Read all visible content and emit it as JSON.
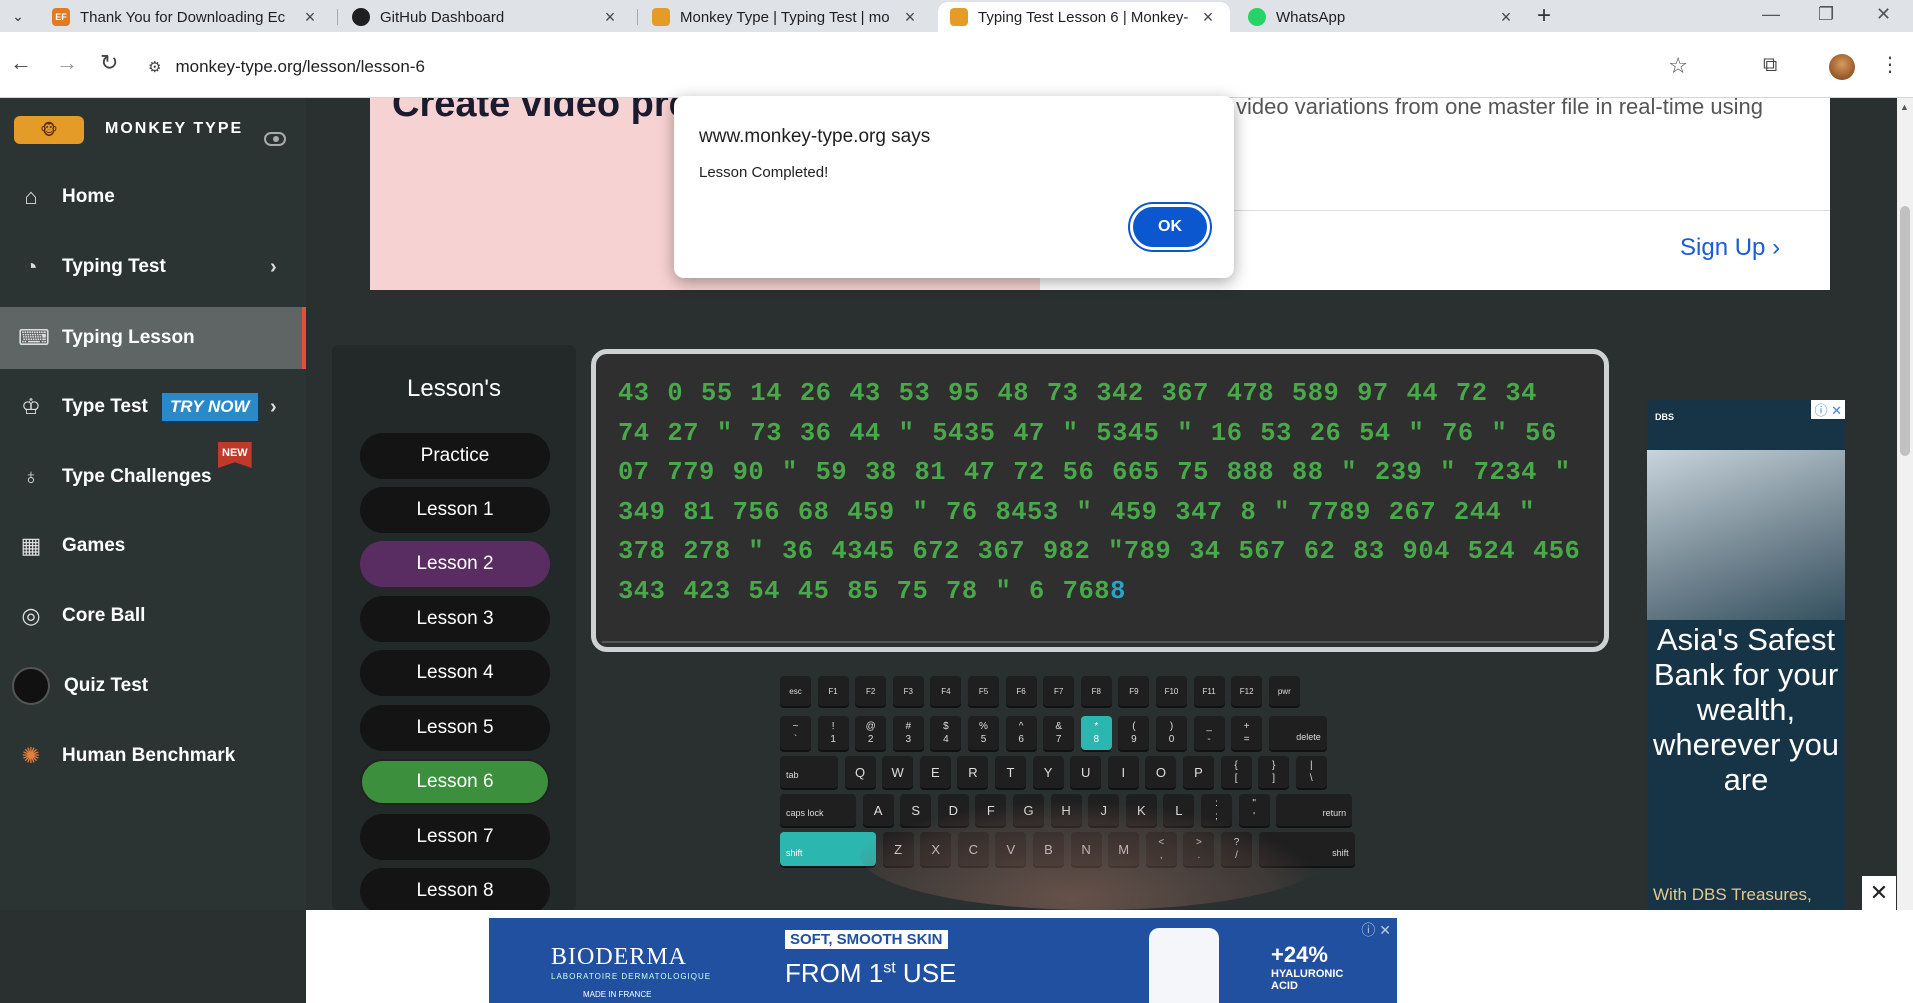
{
  "browser": {
    "tabs": [
      {
        "title": "Thank You for Downloading Ec",
        "icon": "ef-icon",
        "color": "#e27a1f",
        "glyph": "EF"
      },
      {
        "title": "GitHub Dashboard",
        "icon": "github-icon",
        "color": "#1f1f1f",
        "glyph": ""
      },
      {
        "title": "Monkey Type | Typing Test | mo",
        "icon": "monkey-type-icon",
        "color": "#e59b27",
        "glyph": ""
      },
      {
        "title": "Typing Test Lesson 6 | Monkey-",
        "icon": "monkey-type-icon",
        "color": "#e59b27",
        "glyph": ""
      },
      {
        "title": "WhatsApp",
        "icon": "whatsapp-icon",
        "color": "#25d366",
        "glyph": ""
      }
    ],
    "url": "monkey-type.org/lesson/lesson-6"
  },
  "sidebar": {
    "brand": "MONKEY TYPE",
    "items": [
      {
        "label": "Home",
        "icon": "home-icon"
      },
      {
        "label": "Typing Test",
        "icon": "github-icon"
      },
      {
        "label": "Typing Lesson",
        "icon": "keyboard-icon"
      },
      {
        "label": "Type Test",
        "icon": "crown-icon",
        "badge": "TRY NOW"
      },
      {
        "label": "Type Challenges",
        "icon": "award-icon",
        "badge": "NEW"
      },
      {
        "label": "Games",
        "icon": "grid-icon"
      },
      {
        "label": "Core Ball",
        "icon": "target-icon"
      },
      {
        "label": "Quiz Test",
        "icon": "bulb-icon"
      },
      {
        "label": "Human Benchmark",
        "icon": "brain-icon"
      }
    ]
  },
  "top_ad": {
    "headline": "Create video previews in secon",
    "description": "video variations from one master file in real-time using",
    "cta": "Sign Up"
  },
  "lessons_panel": {
    "title": "Lesson's",
    "items": [
      "Practice",
      "Lesson 1",
      "Lesson 2",
      "Lesson 3",
      "Lesson 4",
      "Lesson 5",
      "Lesson 6",
      "Lesson 7",
      "Lesson 8"
    ],
    "visited": "Lesson 2",
    "current": "Lesson 6"
  },
  "typing": {
    "text": "43 0 55 14 26 43 53 95 48 73 342 367 478 589 97 44 72 34 74 27 \" 73 36 44 \" 5435 47 \" 5345 \" 16 53 26 54 \" 76 \" 56 07 779 90 \" 59 38 81 47 72 56 665 75 888 88 \" 239 \" 7234 \" 349 81 756 68 459 \" 76 8453 \" 459 347 8 \" 7789 267 244 \" 378 278 \" 36 4345 672 367 982 \"789 34 567 62 83 904 524 456 343 423 54 45 85 75 78 \" 6 768",
    "cursor_char": "8",
    "typed_color": "#49a84a",
    "cursor_color": "#27a3c7"
  },
  "keyboard": {
    "highlighted_keys": [
      "*",
      "shift"
    ],
    "highlight_color": "#2bb7b0",
    "rows": [
      [
        {
          "t": "esc"
        },
        {
          "t": "F1"
        },
        {
          "t": "F2"
        },
        {
          "t": "F3"
        },
        {
          "t": "F4"
        },
        {
          "t": "F5"
        },
        {
          "t": "F6"
        },
        {
          "t": "F7"
        },
        {
          "t": "F8"
        },
        {
          "t": "F9"
        },
        {
          "t": "F10"
        },
        {
          "t": "F11"
        },
        {
          "t": "F12"
        },
        {
          "t": "pwr"
        }
      ],
      [
        {
          "t": "~",
          "b": "`"
        },
        {
          "t": "!",
          "b": "1"
        },
        {
          "t": "@",
          "b": "2"
        },
        {
          "t": "#",
          "b": "3"
        },
        {
          "t": "$",
          "b": "4"
        },
        {
          "t": "%",
          "b": "5"
        },
        {
          "t": "^",
          "b": "6"
        },
        {
          "t": "&",
          "b": "7"
        },
        {
          "t": "*",
          "b": "8"
        },
        {
          "t": "(",
          "b": "9"
        },
        {
          "t": ")",
          "b": "0"
        },
        {
          "t": "_",
          "b": "-"
        },
        {
          "t": "+",
          "b": "="
        },
        {
          "t": "delete"
        }
      ],
      [
        {
          "t": "tab"
        },
        {
          "t": "Q"
        },
        {
          "t": "W"
        },
        {
          "t": "E"
        },
        {
          "t": "R"
        },
        {
          "t": "T"
        },
        {
          "t": "Y"
        },
        {
          "t": "U"
        },
        {
          "t": "I"
        },
        {
          "t": "O"
        },
        {
          "t": "P"
        },
        {
          "t": "{",
          "b": "["
        },
        {
          "t": "}",
          "b": "]"
        },
        {
          "t": "|",
          "b": "\\"
        }
      ],
      [
        {
          "t": "caps lock"
        },
        {
          "t": "A"
        },
        {
          "t": "S"
        },
        {
          "t": "D"
        },
        {
          "t": "F"
        },
        {
          "t": "G"
        },
        {
          "t": "H"
        },
        {
          "t": "J"
        },
        {
          "t": "K"
        },
        {
          "t": "L"
        },
        {
          "t": ":",
          "b": ";"
        },
        {
          "t": "\"",
          "b": "'"
        },
        {
          "t": "return"
        }
      ],
      [
        {
          "t": "shift"
        },
        {
          "t": "Z"
        },
        {
          "t": "X"
        },
        {
          "t": "C"
        },
        {
          "t": "V"
        },
        {
          "t": "B"
        },
        {
          "t": "N"
        },
        {
          "t": "M"
        },
        {
          "t": "<",
          "b": ","
        },
        {
          "t": ">",
          "b": "."
        },
        {
          "t": "?",
          "b": "/"
        },
        {
          "t": "shift"
        }
      ]
    ]
  },
  "right_ad": {
    "logo": "DBS",
    "message": "Asia's Safest Bank for your wealth, wherever you are",
    "footer": "With DBS Treasures,"
  },
  "bottom_ad": {
    "brand": "BIODERMA",
    "brand_sub": "LABORATOIRE DERMATOLOGIQUE",
    "made_in": "MADE IN FRANCE",
    "tagline": "SOFT, SMOOTH SKIN",
    "offer_prefix": "FROM 1",
    "offer_sup": "st",
    "offer_suffix": " USE",
    "stat": "+24%",
    "stat_label": "HYALURONIC ACID"
  },
  "dialog": {
    "origin": "www.monkey-type.org says",
    "message": "Lesson Completed!",
    "ok_label": "OK"
  }
}
